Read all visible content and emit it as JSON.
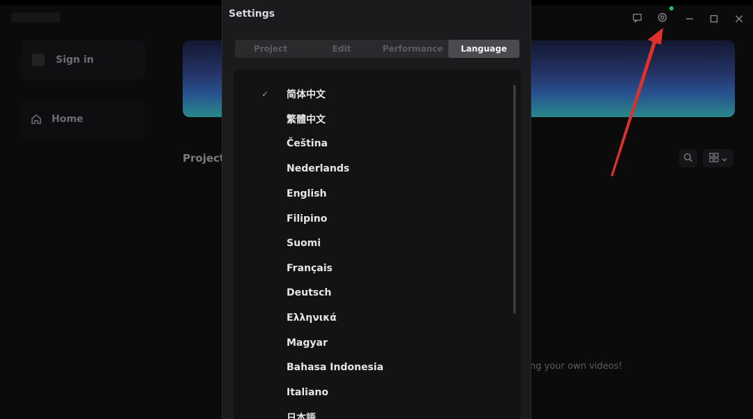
{
  "sidebar": {
    "sign_in_label": "Sign in",
    "home_label": "Home"
  },
  "main": {
    "projects_title": "Projects",
    "empty_hint": "ng your own videos!"
  },
  "settings": {
    "title": "Settings",
    "tabs": [
      {
        "label": "Project",
        "active": false
      },
      {
        "label": "Edit",
        "active": false
      },
      {
        "label": "Performance",
        "active": false
      },
      {
        "label": "Language",
        "active": true
      }
    ],
    "languages": [
      {
        "label": "简体中文",
        "selected": true
      },
      {
        "label": "繁體中文",
        "selected": false
      },
      {
        "label": "Čeština",
        "selected": false
      },
      {
        "label": "Nederlands",
        "selected": false
      },
      {
        "label": "English",
        "selected": false
      },
      {
        "label": "Filipino",
        "selected": false
      },
      {
        "label": "Suomi",
        "selected": false
      },
      {
        "label": "Français",
        "selected": false
      },
      {
        "label": "Deutsch",
        "selected": false
      },
      {
        "label": "Ελληνικά",
        "selected": false
      },
      {
        "label": "Magyar",
        "selected": false
      },
      {
        "label": "Bahasa Indonesia",
        "selected": false
      },
      {
        "label": "Italiano",
        "selected": false
      },
      {
        "label": "日本語",
        "selected": false
      }
    ],
    "check_mark": "✓"
  },
  "colors": {
    "accent_green": "#22c55e",
    "annotation_red": "#e0302a"
  },
  "icons": {
    "feedback": "feedback-icon",
    "settings": "gear-icon",
    "minimize": "minimize-icon",
    "maximize": "maximize-icon",
    "close": "close-icon"
  }
}
